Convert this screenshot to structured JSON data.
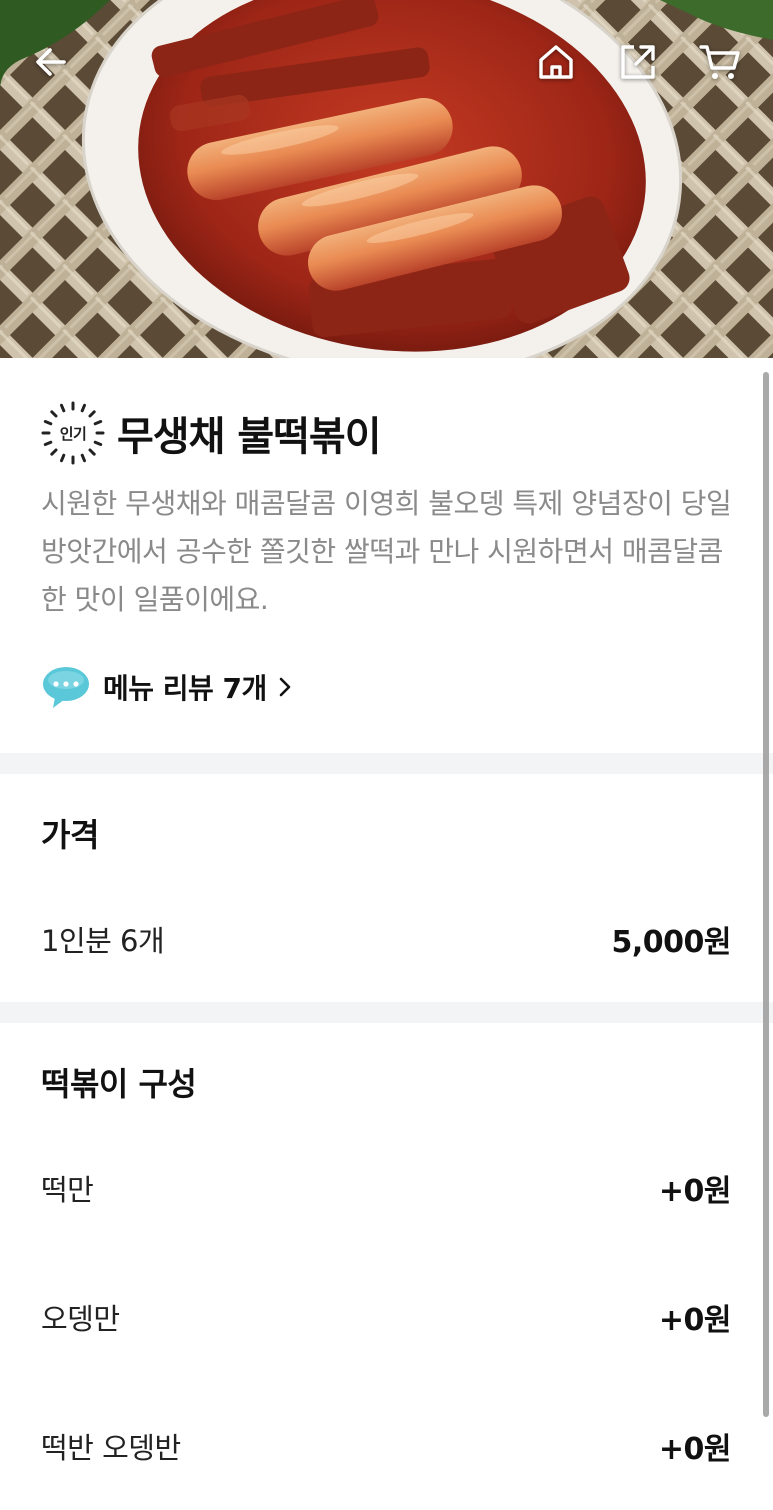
{
  "header": {
    "back_icon": "arrow-left-icon",
    "home_icon": "home-icon",
    "share_icon": "share-icon",
    "cart_icon": "cart-icon"
  },
  "menu": {
    "badge_label": "인기",
    "name": "무생채 불떡볶이",
    "description": "시원한 무생채와 매콤달콤 이영희 불오뎅 특제 양념장이 당일 방앗간에서 공수한 쫄깃한 쌀떡과 만나 시원하면서 매콤달콤한 맛이 일품이에요.",
    "review_link": "메뉴 리뷰 7개"
  },
  "price_section": {
    "title": "가격",
    "option_label": "1인분 6개",
    "option_price": "5,000원"
  },
  "composition_section": {
    "title": "떡볶이 구성",
    "options": [
      {
        "label": "떡만",
        "price": "+0원"
      },
      {
        "label": "오뎅만",
        "price": "+0원"
      },
      {
        "label": "떡반 오뎅반",
        "price": "+0원"
      }
    ]
  },
  "colors": {
    "sauce": "#b8321f",
    "plate": "#f4f1ec",
    "divider": "#f3f4f6",
    "review_bubble": "#5ac8d8"
  }
}
